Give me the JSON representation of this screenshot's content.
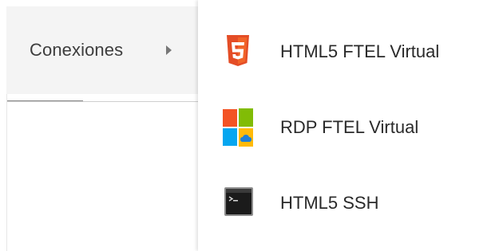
{
  "menu": {
    "connections_label": "Conexiones"
  },
  "submenu": {
    "items": [
      {
        "label": "HTML5 FTEL Virtual",
        "icon": "html5-icon"
      },
      {
        "label": "RDP FTEL Virtual",
        "icon": "windows-icon"
      },
      {
        "label": "HTML5 SSH",
        "icon": "terminal-icon"
      }
    ]
  },
  "colors": {
    "html5_orange": "#e44d26",
    "html5_orange_light": "#f16529",
    "win_red": "#f35325",
    "win_green": "#81bc06",
    "win_blue": "#05a6f0",
    "win_yellow": "#ffba08"
  }
}
